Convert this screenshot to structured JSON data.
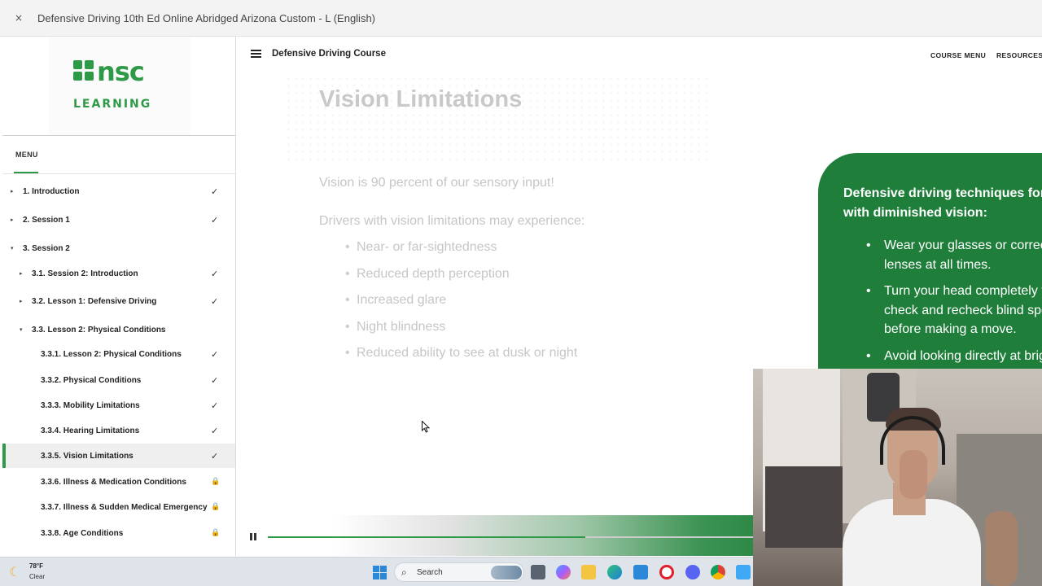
{
  "window": {
    "close_glyph": "×",
    "title": "Defensive Driving 10th Ed Online Abridged Arizona Custom - L (English)"
  },
  "logo": {
    "word": "nsc",
    "subtitle": "LEARNING",
    "color": "#2e9a47"
  },
  "sidebar": {
    "menu_label": "MENU",
    "items": [
      {
        "label": "1. Introduction",
        "level": 0,
        "expanded": false,
        "state": "check"
      },
      {
        "label": "2. Session 1",
        "level": 0,
        "expanded": false,
        "state": "check"
      },
      {
        "label": "3. Session 2",
        "level": 0,
        "expanded": true,
        "state": ""
      },
      {
        "label": "3.1. Session 2: Introduction",
        "level": 1,
        "expanded": false,
        "state": "check"
      },
      {
        "label": "3.2. Lesson 1: Defensive Driving",
        "level": 1,
        "expanded": false,
        "state": "check"
      },
      {
        "label": "3.3. Lesson 2: Physical Conditions",
        "level": 1,
        "expanded": true,
        "state": ""
      },
      {
        "label": "3.3.1. Lesson 2: Physical Conditions",
        "level": 2,
        "state": "check"
      },
      {
        "label": "3.3.2. Physical Conditions",
        "level": 2,
        "state": "check"
      },
      {
        "label": "3.3.3. Mobility Limitations",
        "level": 2,
        "state": "check"
      },
      {
        "label": "3.3.4. Hearing Limitations",
        "level": 2,
        "state": "check"
      },
      {
        "label": "3.3.5. Vision Limitations",
        "level": 2,
        "state": "check",
        "active": true
      },
      {
        "label": "3.3.6. Illness & Medication Conditions",
        "level": 2,
        "state": "lock"
      },
      {
        "label": "3.3.7. Illness & Sudden Medical Emergency",
        "level": 2,
        "state": "lock"
      },
      {
        "label": "3.3.8. Age Conditions",
        "level": 2,
        "state": "lock"
      }
    ],
    "check_glyph": "✓",
    "lock_glyph": "🔒",
    "caret_collapsed": "▸",
    "caret_expanded": "▾"
  },
  "topbar": {
    "course_title": "Defensive Driving Course",
    "links": [
      "COURSE MENU",
      "RESOURCES"
    ]
  },
  "slide": {
    "title": "Vision Limitations",
    "intro": "Vision is 90 percent of our sensory input!",
    "lead": "Drivers with vision limitations may experience:",
    "bullets": [
      "Near- or far-sightedness",
      "Reduced depth perception",
      "Increased glare",
      "Night blindness",
      "Reduced ability to see at dusk or night"
    ]
  },
  "panel": {
    "heading": "Defensive driving techniques for drivers with diminished vision:",
    "bullets": [
      "Wear your glasses or corrective\nlenses at all times.",
      "Turn your head completely to\ncheck and recheck blind spots\nbefore making a move.",
      "Avoid looking directly at bright\nlights as they may temporarily\nblind you."
    ],
    "color": "#1f7f3a"
  },
  "player": {
    "progress": 0.65
  },
  "taskbar": {
    "weather_icon": "moon-icon",
    "weather_glyph": "☾",
    "temperature": "78°F",
    "condition": "Clear",
    "search_label": "Search",
    "search_glyph": "⌕",
    "apps": [
      "file-explorer-icon",
      "copilot-icon",
      "folder-icon",
      "edge-icon",
      "store-icon",
      "opera-icon",
      "discord-icon",
      "chrome-icon",
      "notepad-icon"
    ]
  }
}
